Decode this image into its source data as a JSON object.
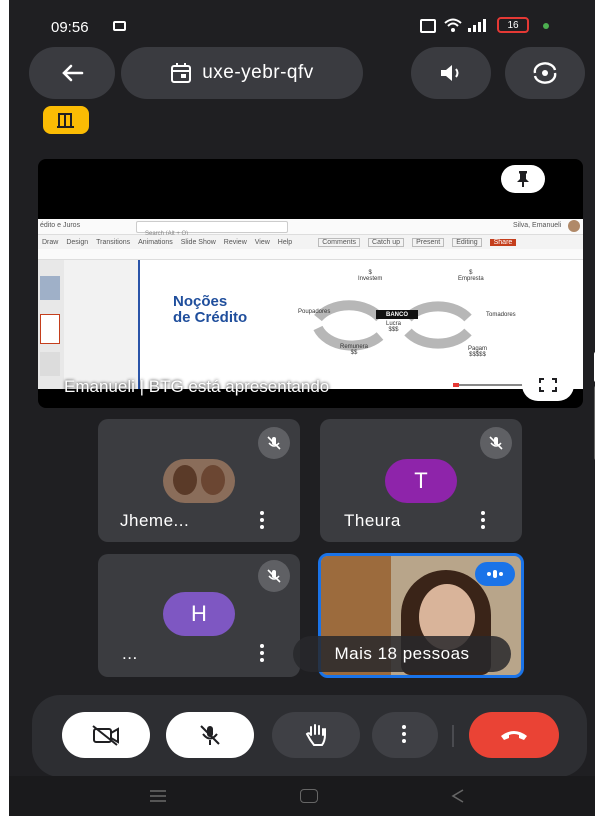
{
  "status_bar": {
    "time": "09:56",
    "battery": "16"
  },
  "top_bar": {
    "meeting_code": "uxe-yebr-qfv"
  },
  "presentation": {
    "caption": "Emanueli | BTG está apresentando",
    "slide": {
      "title_line1": "Noções",
      "title_line2": "de Crédito",
      "investem": "$\nInvestem",
      "empresta": "$\nEmpresta",
      "poupadores": "Poupadores",
      "tomadores": "Tomadores",
      "banco": "BANCO",
      "lucra": "Lucra\n$$$",
      "remunera": "Remunera\n$$",
      "pagam": "Pagam\n$$$$$"
    },
    "app_ui": {
      "tabs": [
        "Draw",
        "Design",
        "Transitions",
        "Animations",
        "Slide Show",
        "Review",
        "View",
        "Help"
      ],
      "search": "Search (Alt + Q)",
      "doc_title": "édito e Juros",
      "user": "Silva, Emanueli",
      "comments": "Comments",
      "catch_up": "Catch up",
      "present": "Present",
      "editing": "Editing",
      "share": "Share"
    }
  },
  "participants": [
    {
      "name": "Jheme...",
      "type": "photo"
    },
    {
      "name": "Theura",
      "type": "letter",
      "letter": "T",
      "color": "#8e24aa"
    },
    {
      "name": "...",
      "type": "letter",
      "letter": "H",
      "color": "#7e57c2"
    },
    {
      "name": "Mais 18 pessoas",
      "type": "video"
    }
  ]
}
